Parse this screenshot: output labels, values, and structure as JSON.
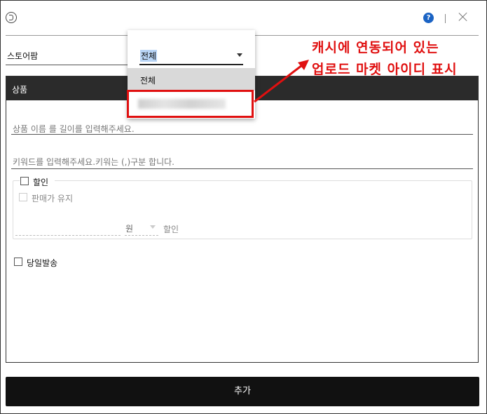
{
  "header": {
    "help_label": "?"
  },
  "store": {
    "label": "스토어팜"
  },
  "dropdown": {
    "selected": "전체",
    "options": [
      "전체"
    ]
  },
  "panel": {
    "title": "상품"
  },
  "fields": {
    "product_name_placeholder": "상품 이름 를 길이를 입력해주세요.",
    "keyword_placeholder": "키워드를 입력해주세요.키워는 (,)구분 합니다."
  },
  "discount": {
    "label": "할인",
    "keep_price_label": "판매가 유지",
    "unit": "원",
    "suffix": "할인"
  },
  "same_day": {
    "label": "당일발송"
  },
  "actions": {
    "add_label": "추가"
  },
  "annotation": {
    "line1": "캐시에 연동되어 있는",
    "line2": "업로드 마켓 아이디 표시",
    "color": "#e01010"
  }
}
